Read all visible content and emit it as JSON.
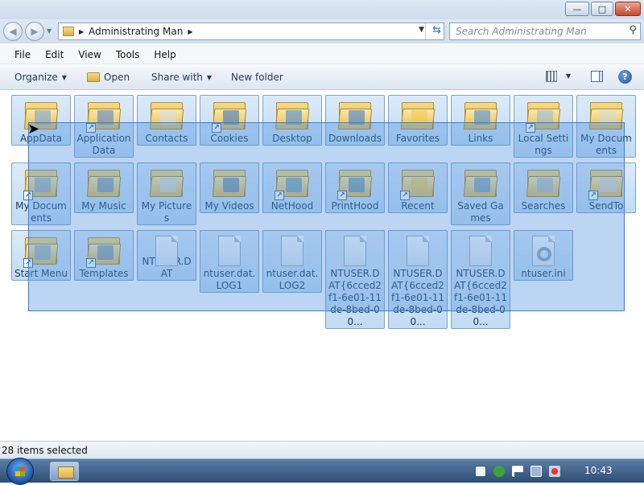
{
  "window": {
    "minimize": "—",
    "maximize": "□",
    "close": "✕"
  },
  "address": {
    "path": "Administrating Man",
    "search_placeholder": "Search Administrating Man"
  },
  "menu": [
    "File",
    "Edit",
    "View",
    "Tools",
    "Help"
  ],
  "commands": {
    "organize": "Organize",
    "open": "Open",
    "share": "Share with",
    "new_folder": "New folder"
  },
  "items": [
    {
      "label": "AppData",
      "type": "folder",
      "shortcut": false
    },
    {
      "label": "Application Data",
      "type": "folder",
      "shortcut": true
    },
    {
      "label": "Contacts",
      "type": "folder",
      "shortcut": false
    },
    {
      "label": "Cookies",
      "type": "folder",
      "shortcut": true
    },
    {
      "label": "Desktop",
      "type": "folder",
      "shortcut": false
    },
    {
      "label": "Downloads",
      "type": "folder",
      "shortcut": false
    },
    {
      "label": "Favorites",
      "type": "folder",
      "shortcut": false
    },
    {
      "label": "Links",
      "type": "folder",
      "shortcut": false
    },
    {
      "label": "Local Settings",
      "type": "folder",
      "shortcut": true
    },
    {
      "label": "My Documents",
      "type": "folder",
      "shortcut": false
    },
    {
      "label": "My Documents",
      "type": "folder",
      "shortcut": true
    },
    {
      "label": "My Music",
      "type": "folder",
      "shortcut": false
    },
    {
      "label": "My Pictures",
      "type": "folder",
      "shortcut": false
    },
    {
      "label": "My Videos",
      "type": "folder",
      "shortcut": false
    },
    {
      "label": "NetHood",
      "type": "folder",
      "shortcut": true
    },
    {
      "label": "PrintHood",
      "type": "folder",
      "shortcut": true
    },
    {
      "label": "Recent",
      "type": "folder",
      "shortcut": true
    },
    {
      "label": "Saved Games",
      "type": "folder",
      "shortcut": false
    },
    {
      "label": "Searches",
      "type": "folder",
      "shortcut": false
    },
    {
      "label": "SendTo",
      "type": "folder",
      "shortcut": true
    },
    {
      "label": "Start Menu",
      "type": "folder",
      "shortcut": true
    },
    {
      "label": "Templates",
      "type": "folder",
      "shortcut": true
    },
    {
      "label": "NTUSER.DAT",
      "type": "file",
      "shortcut": false
    },
    {
      "label": "ntuser.dat.LOG1",
      "type": "file",
      "shortcut": false
    },
    {
      "label": "ntuser.dat.LOG2",
      "type": "file",
      "shortcut": false
    },
    {
      "label": "NTUSER.DAT{6cced2f1-6e01-11de-8bed-00...",
      "type": "file",
      "shortcut": false
    },
    {
      "label": "NTUSER.DAT{6cced2f1-6e01-11de-8bed-00...",
      "type": "file",
      "shortcut": false
    },
    {
      "label": "NTUSER.DAT{6cced2f1-6e01-11de-8bed-00...",
      "type": "file",
      "shortcut": false
    },
    {
      "label": "ntuser.ini",
      "type": "settings-file",
      "shortcut": false
    }
  ],
  "status": {
    "text": "28 items selected"
  },
  "taskbar": {
    "clock": "10:43"
  }
}
